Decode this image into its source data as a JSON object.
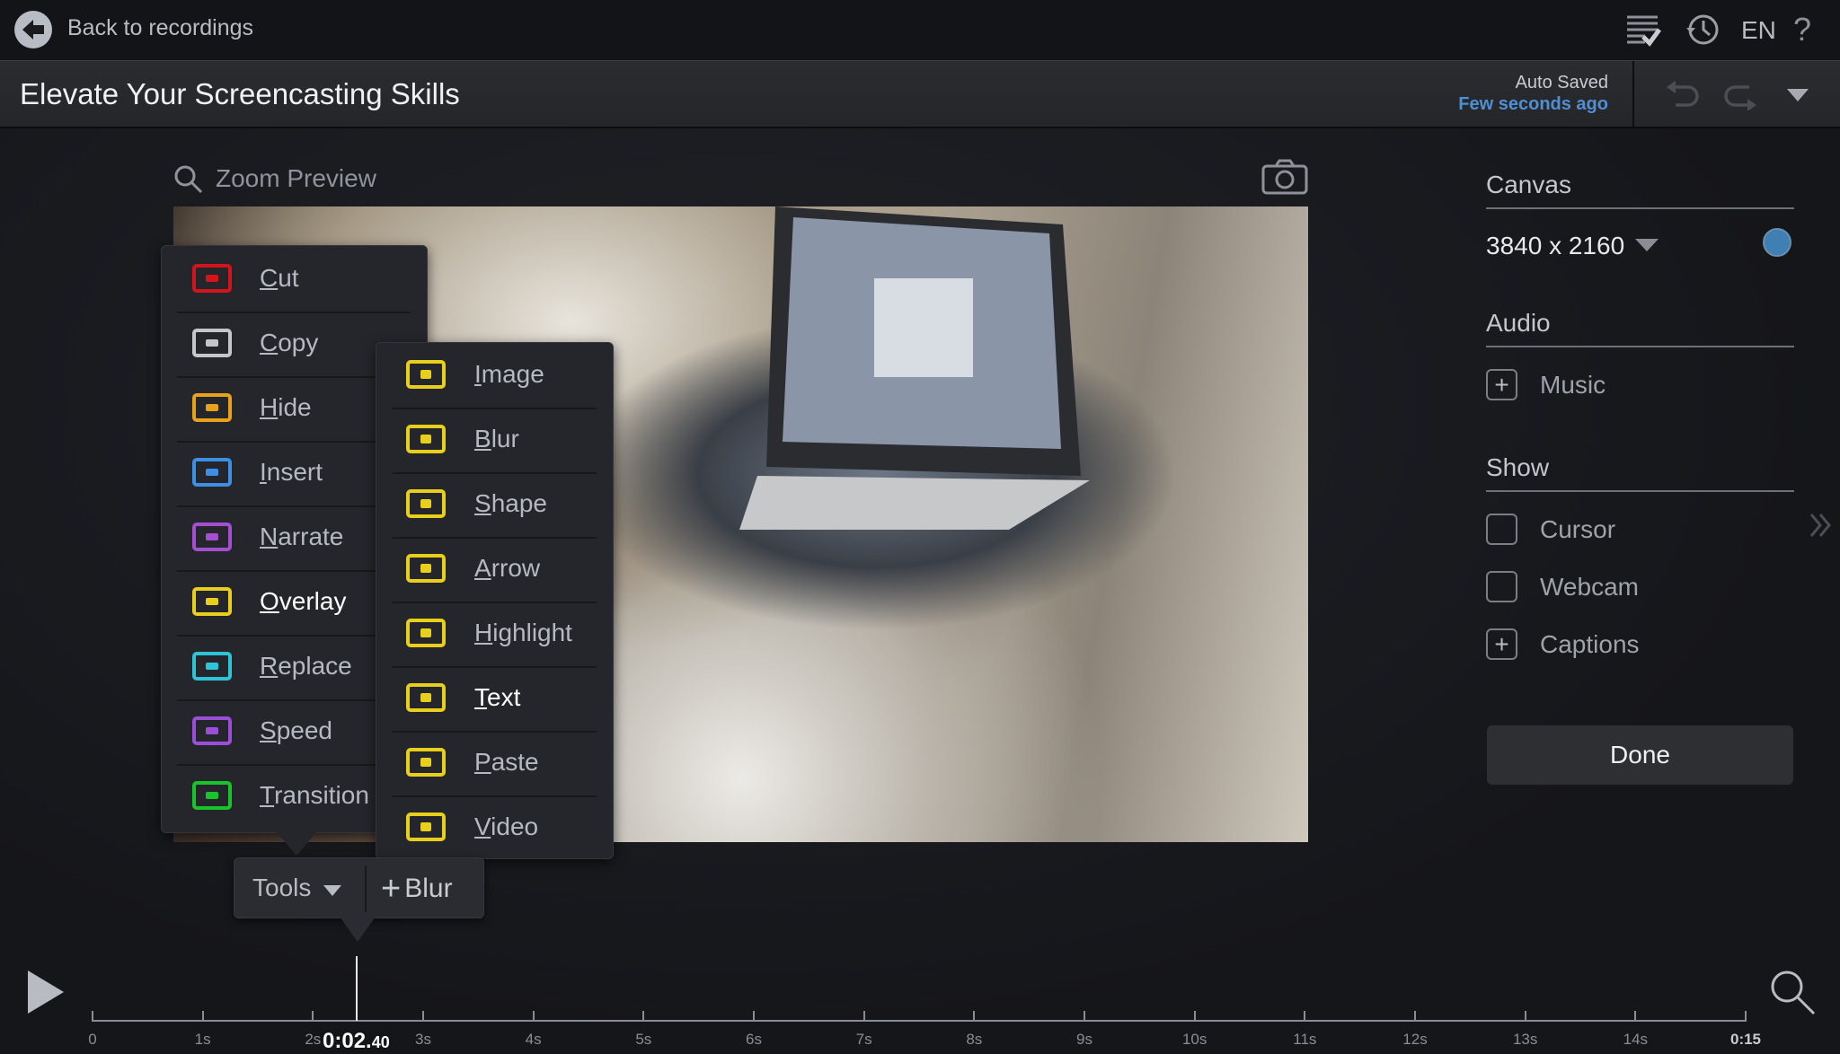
{
  "topbar": {
    "back_label": "Back to recordings",
    "icons": [
      "checklist-icon",
      "history-icon"
    ],
    "language": "EN",
    "help": "?"
  },
  "titlebar": {
    "title": "Elevate Your Screencasting Skills",
    "autosave_label": "Auto Saved",
    "autosave_time": "Few seconds ago"
  },
  "preview": {
    "zoom_label": "Zoom Preview"
  },
  "tools_menu": {
    "items": [
      {
        "label": "Cut",
        "color": "#d3151b",
        "icon": "scissors-icon"
      },
      {
        "label": "Copy",
        "color": "#c4c6ca",
        "icon": "copy-icon"
      },
      {
        "label": "Hide",
        "color": "#e8a21a",
        "icon": "closed-eye-icon"
      },
      {
        "label": "Insert",
        "color": "#3d8fe6",
        "icon": "insert-icon"
      },
      {
        "label": "Narrate",
        "color": "#a34fd0",
        "icon": "microphone-icon"
      },
      {
        "label": "Overlay",
        "color": "#e8cf1c",
        "icon": "triangle-icon"
      },
      {
        "label": "Replace",
        "color": "#2ec4d8",
        "icon": "replace-icon"
      },
      {
        "label": "Speed",
        "color": "#9b4fd6",
        "icon": "speed-icon"
      },
      {
        "label": "Transition",
        "color": "#19c42a",
        "icon": "transition-icon"
      }
    ],
    "active": "Overlay"
  },
  "overlay_submenu": {
    "color": "#e8cf1c",
    "items": [
      {
        "label": "Image",
        "icon": "image-icon"
      },
      {
        "label": "Blur",
        "icon": "blur-drop-icon"
      },
      {
        "label": "Shape",
        "icon": "shape-icon"
      },
      {
        "label": "Arrow",
        "icon": "arrow-icon"
      },
      {
        "label": "Highlight",
        "icon": "sparkle-icon"
      },
      {
        "label": "Text",
        "icon": "text-icon"
      },
      {
        "label": "Paste",
        "icon": "paste-icon"
      },
      {
        "label": "Video",
        "icon": "video-play-icon"
      }
    ],
    "active": "Text"
  },
  "tools_bar": {
    "tools_label": "Tools",
    "add_label": "Blur"
  },
  "right_panel": {
    "canvas_heading": "Canvas",
    "canvas_size": "3840 x 2160",
    "canvas_color": "#3f7fb3",
    "audio_heading": "Audio",
    "music_label": "Music",
    "show_heading": "Show",
    "cursor_label": "Cursor",
    "cursor_checked": false,
    "webcam_label": "Webcam",
    "webcam_checked": false,
    "captions_label": "Captions",
    "done_label": "Done"
  },
  "timeline": {
    "current_time_main": "0:02.",
    "current_time_frac": "40",
    "current_seconds": 2.4,
    "duration_seconds": 15,
    "ticks": [
      "0",
      "1s",
      "2s",
      "3s",
      "4s",
      "5s",
      "6s",
      "7s",
      "8s",
      "9s",
      "10s",
      "11s",
      "12s",
      "13s",
      "14s",
      "0:15"
    ]
  }
}
